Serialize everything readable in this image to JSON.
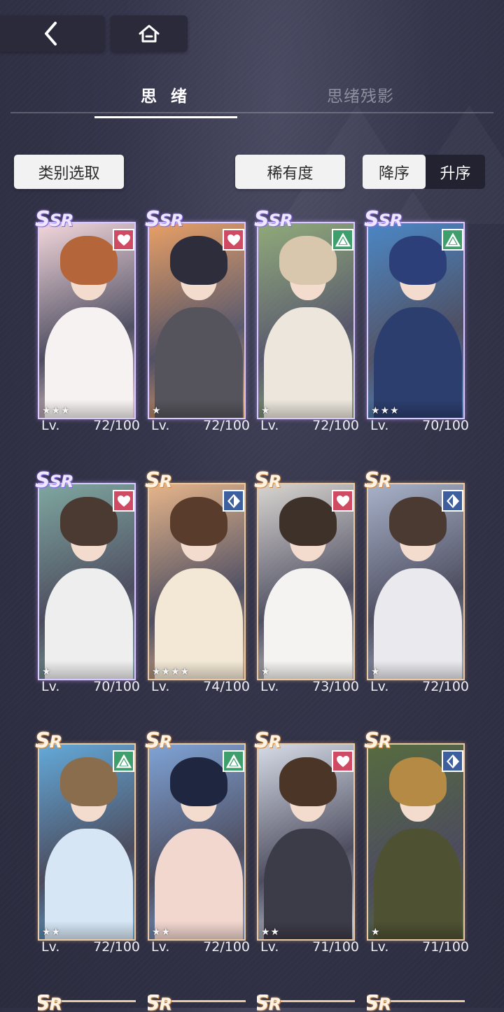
{
  "tabs": [
    {
      "label": "思 绪",
      "active": true
    },
    {
      "label": "思绪残影",
      "active": false
    }
  ],
  "filters": {
    "category_label": "类别选取",
    "rarity_label": "稀有度",
    "sort_desc_label": "降序",
    "sort_asc_label": "升序",
    "selected_sort": "降序"
  },
  "cards": [
    {
      "rarity": "SSR",
      "type_icon": "heart-icon",
      "stars": "★★★",
      "lv_label": "Lv.",
      "level": "72/100",
      "art": {
        "hair": "#b4653a",
        "body": "#f7f2f2",
        "bg": "#f3d7dc"
      }
    },
    {
      "rarity": "SSR",
      "type_icon": "heart-icon",
      "stars": "★",
      "lv_label": "Lv.",
      "level": "72/100",
      "art": {
        "hair": "#2d2d3c",
        "body": "#55545c",
        "bg": "#e9a066"
      }
    },
    {
      "rarity": "SSR",
      "type_icon": "triangle-icon",
      "stars": "★",
      "lv_label": "Lv.",
      "level": "72/100",
      "art": {
        "hair": "#d9c7ad",
        "body": "#ece6dc",
        "bg": "#8fa979"
      }
    },
    {
      "rarity": "SSR",
      "type_icon": "triangle-icon",
      "stars": "★★★",
      "lv_label": "Lv.",
      "level": "70/100",
      "art": {
        "hair": "#2c3f78",
        "body": "#2c3e6e",
        "bg": "#4a86c4"
      }
    },
    {
      "rarity": "SSR",
      "type_icon": "heart-icon",
      "stars": "★",
      "lv_label": "Lv.",
      "level": "70/100",
      "art": {
        "hair": "#4a3a32",
        "body": "#eeeeee",
        "bg": "#7fa7a0"
      }
    },
    {
      "rarity": "SR",
      "type_icon": "diamond-icon",
      "stars": "★★★★",
      "lv_label": "Lv.",
      "level": "74/100",
      "art": {
        "hair": "#5a3c2c",
        "body": "#f3e8d6",
        "bg": "#e6b58a"
      }
    },
    {
      "rarity": "SR",
      "type_icon": "heart-icon",
      "stars": "★",
      "lv_label": "Lv.",
      "level": "73/100",
      "art": {
        "hair": "#3e312a",
        "body": "#f4f3f1",
        "bg": "#d7d4cf"
      }
    },
    {
      "rarity": "SR",
      "type_icon": "diamond-icon",
      "stars": "★",
      "lv_label": "Lv.",
      "level": "72/100",
      "art": {
        "hair": "#4b3a31",
        "body": "#e9e9ee",
        "bg": "#a7b1c8"
      }
    },
    {
      "rarity": "SR",
      "type_icon": "triangle-icon",
      "stars": "★★",
      "lv_label": "Lv.",
      "level": "72/100",
      "art": {
        "hair": "#8a6d4c",
        "body": "#d6e6f5",
        "bg": "#63a9d9"
      }
    },
    {
      "rarity": "SR",
      "type_icon": "triangle-icon",
      "stars": "★★",
      "lv_label": "Lv.",
      "level": "72/100",
      "art": {
        "hair": "#1f2740",
        "body": "#f2d7cf",
        "bg": "#7fa3d6"
      }
    },
    {
      "rarity": "SR",
      "type_icon": "heart-icon",
      "stars": "★★",
      "lv_label": "Lv.",
      "level": "71/100",
      "art": {
        "hair": "#4a3527",
        "body": "#3c3b48",
        "bg": "#d5dbe6"
      }
    },
    {
      "rarity": "SR",
      "type_icon": "diamond-icon",
      "stars": "★",
      "lv_label": "Lv.",
      "level": "71/100",
      "art": {
        "hair": "#b58a45",
        "body": "#4f5133",
        "bg": "#566b3f"
      }
    }
  ],
  "partial_cards": [
    {
      "rarity": "SR"
    },
    {
      "rarity": "SR"
    },
    {
      "rarity": "SR"
    },
    {
      "rarity": "SR"
    }
  ]
}
